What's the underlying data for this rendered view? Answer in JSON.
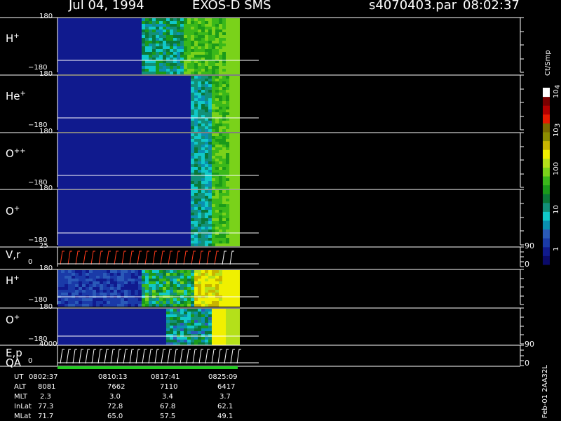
{
  "header": {
    "date": "Jul 04, 1994",
    "instrument": "EXOS-D SMS",
    "file": "s4070403.par",
    "time": "08:02:37"
  },
  "colors": {
    "background": "#000000",
    "frame": "#ffffff",
    "qa_bar": "#22cc22",
    "ramp_red": "#ff3a1a",
    "palette": [
      "#0a0a6a",
      "#101a8e",
      "#1a3aa8",
      "#2a5ab8",
      "#0a8fb0",
      "#10c8c8",
      "#129078",
      "#0a7838",
      "#1a9a1a",
      "#3ab81a",
      "#7ad21a",
      "#b4e01a",
      "#f0f000",
      "#c8b400",
      "#8c8c00",
      "#7a6a00",
      "#e81a00",
      "#b40000",
      "#7a0000",
      "#ffffff"
    ]
  },
  "colorbar": {
    "unit": "Ct/Smp",
    "ticks": [
      "1",
      "10",
      "100",
      "10",
      "3",
      "10",
      "4"
    ]
  },
  "chart_data": {
    "type": "heatmap",
    "panels": [
      {
        "label": "H",
        "sup": "+",
        "ymax": "180",
        "ymin": "−180",
        "right_max": "",
        "right_min": ""
      },
      {
        "label": "He",
        "sup": "+",
        "ymax": "180",
        "ymin": "−180",
        "right_max": "",
        "right_min": ""
      },
      {
        "label": "O",
        "sup": "++",
        "ymax": "180",
        "ymin": "−180",
        "right_max": "",
        "right_min": ""
      },
      {
        "label": "O",
        "sup": "+",
        "ymax": "180",
        "ymin": "−180",
        "right_max": "",
        "right_min": ""
      },
      {
        "label": "V,r",
        "sup": "",
        "ymax": "25",
        "ymin": "0",
        "right_max": "90",
        "right_min": "0"
      },
      {
        "label": "H",
        "sup": "+",
        "ymax": "180",
        "ymin": "−180",
        "right_max": "",
        "right_min": ""
      },
      {
        "label": "O",
        "sup": "+",
        "ymax": "180",
        "ymin": "−180",
        "right_max": "",
        "right_min": ""
      },
      {
        "label": "E,p",
        "sup": "",
        "ymax": "4000",
        "ymin": "0",
        "right_max": "90",
        "right_min": "0"
      }
    ],
    "qa_label": "QA",
    "data_coverage": {
      "start": "08:02:37",
      "end_fraction": 0.39
    },
    "time_table": {
      "rows": [
        {
          "name": "UT",
          "values": [
            "0802:37",
            "0810:13",
            "0817:41",
            "0825:09"
          ]
        },
        {
          "name": "ALT",
          "values": [
            "8081",
            "7662",
            "7110",
            "6417"
          ]
        },
        {
          "name": "MLT",
          "values": [
            "2.3",
            "3.0",
            "3.4",
            "3.7"
          ]
        },
        {
          "name": "InLat",
          "values": [
            "77.3",
            "72.8",
            "67.8",
            "62.1"
          ]
        },
        {
          "name": "MLat",
          "values": [
            "71.7",
            "65.0",
            "57.5",
            "49.1"
          ]
        }
      ]
    }
  },
  "side_label": "Feb-01 2AA32L"
}
